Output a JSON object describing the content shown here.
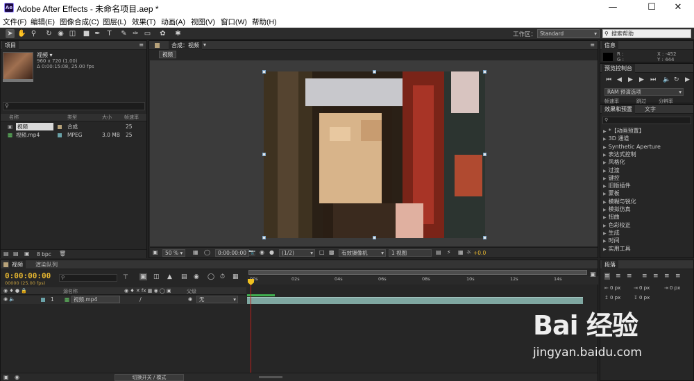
{
  "window": {
    "app_icon": "Ae",
    "title": "Adobe After Effects - 未命名项目.aep *",
    "min_icon": "minimize-icon",
    "max_icon": "maximize-icon",
    "close_icon": "close-icon"
  },
  "menu": [
    "文件(F)",
    "编辑(E)",
    "图像合成(C)",
    "图层(L)",
    "效果(T)",
    "动画(A)",
    "视图(V)",
    "窗口(W)",
    "帮助(H)"
  ],
  "toolbar": {
    "workspace_label": "工作区：",
    "workspace_value": "Standard",
    "search_placeholder": "搜索帮助"
  },
  "project": {
    "tabs": [
      "项目"
    ],
    "selected_name": "视频 ▾",
    "selected_info1": "960 x 720 (1.00)",
    "selected_info2": "Δ 0:00:15:08, 25.00 fps",
    "columns": [
      "名称",
      "类型",
      "大小",
      "帧速率"
    ],
    "items": [
      {
        "name": "视频",
        "type": "合成",
        "size": "",
        "fps": "25",
        "color": "#b7a27a"
      },
      {
        "name": "视频.mp4",
        "type": "MPEG",
        "size": "3.0 MB",
        "fps": "25",
        "color": "#6aa2a8"
      }
    ],
    "bpc": "8 bpc"
  },
  "composition": {
    "tab": "合成：视频",
    "breadcrumb": "视频",
    "zoom": "50 %",
    "timecode": "0:00:00:00",
    "resolution": "(1/2)",
    "camera": "有效摄像机",
    "views": "1 视图",
    "exposure": "+0.0"
  },
  "info": {
    "tab": "信息",
    "r_label": "R :",
    "g_label": "G :",
    "x_label": "X : -452",
    "y_label": "Y : 444"
  },
  "preview": {
    "tab": "预览控制台",
    "ram_label": "RAM 预演选项",
    "row_labels": [
      "帧速率",
      "跳过",
      "分辨率"
    ]
  },
  "effects": {
    "tabs": [
      "效果和预置",
      "文字"
    ],
    "items": [
      "*【动画预置】",
      "3D 通道",
      "Synthetic Aperture",
      "表达式控制",
      "风格化",
      "过渡",
      "键控",
      "旧版插件",
      "蒙板",
      "模糊与锐化",
      "模拟仿真",
      "扭曲",
      "色彩校正",
      "生成",
      "时间",
      "实用工具"
    ]
  },
  "timeline": {
    "tabs": [
      "视频",
      "渲染队列"
    ],
    "timecode": "0:00:00:00",
    "timecode_sub": "00000 (25.00 fps)",
    "col_source": "源名称",
    "col_parent": "父级",
    "layer": {
      "index": "1",
      "name": "视频.mp4",
      "parent": "无"
    },
    "ruler": [
      "00s",
      "02s",
      "04s",
      "06s",
      "08s",
      "10s",
      "12s",
      "14s"
    ],
    "toggle_label": "切换开关 / 模式"
  },
  "paragraph": {
    "tab": "段落",
    "values": [
      "0 px",
      "0 px",
      "0 px",
      "0 px",
      "0 px"
    ]
  },
  "watermark": {
    "logo": "Bai 经验",
    "url": "jingyan.baidu.com"
  },
  "colors": {
    "accent_timecode": "#e8b830",
    "layer_bar": "#7fa7a1",
    "playhead": "#c0201c"
  }
}
